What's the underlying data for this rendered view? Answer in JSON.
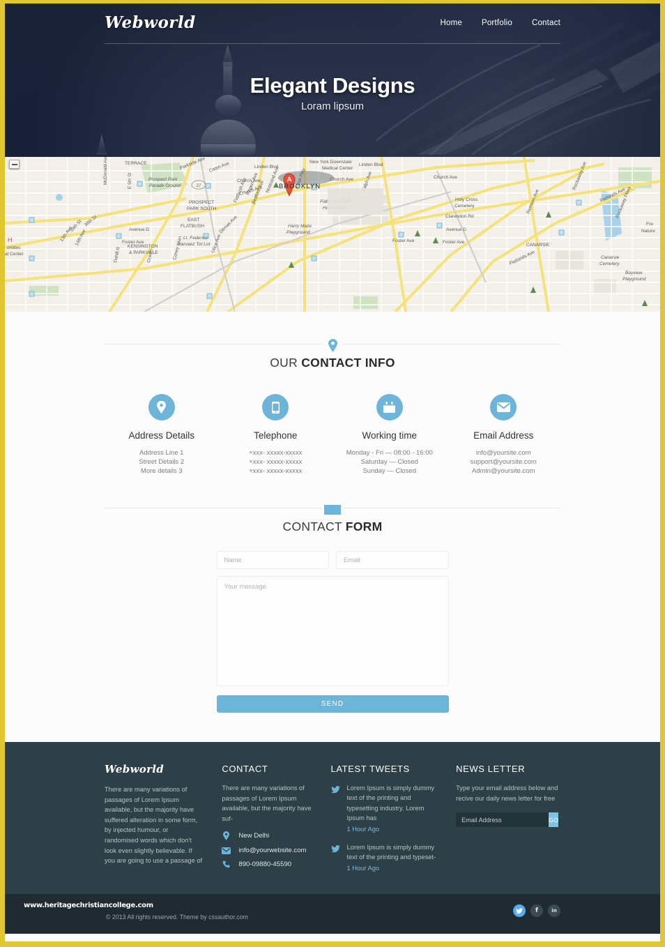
{
  "theme": {
    "accent": "#6cb5d8",
    "border": "#e2c62f",
    "hero_bg": "#18203a",
    "footer_bg": "#2d4048",
    "bottom_bg": "#1f2a31"
  },
  "header": {
    "logo": "Webworld",
    "nav": [
      {
        "label": "Home"
      },
      {
        "label": "Portfolio"
      },
      {
        "label": "Contact"
      }
    ]
  },
  "hero": {
    "title": "Elegant Designs",
    "subtitle": "Loram lipsum"
  },
  "map": {
    "marker_label": "A",
    "city_label": "BROOKLYN",
    "labels": [
      "TERRACE",
      "Parkside Ave",
      "Linden Blvd",
      "New York Downstate",
      "Medical Center",
      "Prospect Park",
      "Parade Ground",
      "Caton Ave",
      "Church Ave",
      "E 5th St",
      "McDonald Ave",
      "27",
      "PROSPECT",
      "PARK SOUTH",
      "Rogers Ave",
      "Nostrand Ave",
      "Flatbush Ave",
      "Bedford Ave",
      "Ralph Ave",
      "Holy Cross",
      "Cemetery",
      "Fidler-Wyckoff",
      "House Park",
      "Kings Hwy",
      "Clarendon Rd",
      "EAST",
      "FLATBUSH",
      "Avenue D",
      "Harry Maze",
      "Playground",
      "Remsen Ave",
      "Rockaway Ave",
      "Foster Ave",
      "Rockaway Pkwy",
      "CANARSIE",
      "Flatlands Ave",
      "Canarsie",
      "Cemetery",
      "Utica Ave",
      "Bayview",
      "Playground",
      "Ditmas Ave",
      "Lt. Federico",
      "Narvaez Tot Lot",
      "KENSINGTON",
      "& PARKVILLE",
      "Dahill R",
      "Ocean",
      "Coney Islan",
      "39th St",
      "38th St",
      "13th Ave",
      "14th Ave",
      "Fre",
      "Nature",
      "onides",
      "al Center",
      "H"
    ]
  },
  "contact_info": {
    "title_light": "OUR ",
    "title_bold": "CONTACT INFO",
    "items": [
      {
        "icon": "map-pin-icon",
        "name": "Address Details",
        "lines": [
          "Address Line 1",
          "Street Details 2",
          "More details 3"
        ]
      },
      {
        "icon": "phone-icon",
        "name": "Telephone",
        "lines": [
          "+xxx- xxxxx-xxxxx",
          "+xxx- xxxxx-xxxxx",
          "+xxx- xxxxx-xxxxx"
        ]
      },
      {
        "icon": "calendar-icon",
        "name": "Working time",
        "lines": [
          "Monday - Fri — 08:00 - 16:00",
          "Saturday — Closed",
          "Sunday — Closed"
        ]
      },
      {
        "icon": "envelope-icon",
        "name": "Email Address",
        "lines": [
          "info@yoursite.com",
          "support@yoursite.com",
          "Admin@yoursite.com"
        ]
      }
    ]
  },
  "contact_form": {
    "title_light": "CONTACT ",
    "title_bold": "FORM",
    "name_placeholder": "Name",
    "email_placeholder": "Email",
    "message_placeholder": "Your message",
    "send_label": "SEND"
  },
  "footer": {
    "about": {
      "logo": "Webworld",
      "text": "There are many variations of passages of Lorem Ipsum available, but the majority have suffered alteration in some form, by injected humour, or randomised words which don't look even slightly believable. If you are going to use a passage of"
    },
    "contact": {
      "heading": "CONTACT",
      "text": "There are many variations of passages of Lorem Ipsum available, but the majority have suf-",
      "rows": [
        {
          "icon": "map-pin-icon",
          "value": "New Delhi"
        },
        {
          "icon": "envelope-icon",
          "value": "info@yourwebsite.com"
        },
        {
          "icon": "phone-icon",
          "value": "890-09880-45590"
        }
      ]
    },
    "tweets": {
      "heading": "LATEST TWEETS",
      "items": [
        {
          "text": "Lorem Ipsum is simply dummy text of the printing and typesetting industry. Lorem Ipsum has",
          "time": "1 Hour Ago"
        },
        {
          "text": "Lorem Ipsum is simply dummy text of the printing and typeset-",
          "time": "1 Hour Ago"
        }
      ]
    },
    "newsletter": {
      "heading": "NEWS LETTER",
      "text": "Type your email address below and recive our daily news letter for free",
      "placeholder": "Email Address",
      "button": "GO"
    }
  },
  "bottom": {
    "watermark": "www.heritagechristiancollege.com",
    "copyright": "© 2013 All rights reserved.  Theme by cssauthor.com",
    "socials": [
      {
        "name": "twitter",
        "glyph": "t"
      },
      {
        "name": "facebook",
        "glyph": "f"
      },
      {
        "name": "linkedin",
        "glyph": "in"
      }
    ]
  }
}
